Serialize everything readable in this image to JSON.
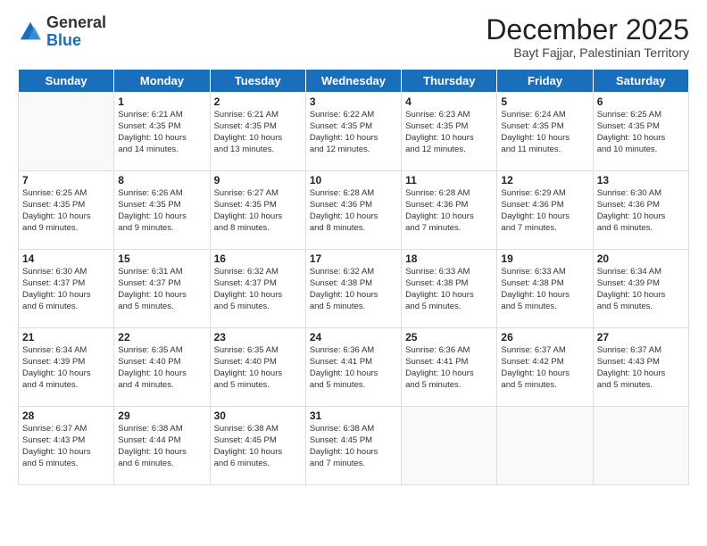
{
  "header": {
    "logo_general": "General",
    "logo_blue": "Blue",
    "month_title": "December 2025",
    "subtitle": "Bayt Fajjar, Palestinian Territory"
  },
  "days": [
    "Sunday",
    "Monday",
    "Tuesday",
    "Wednesday",
    "Thursday",
    "Friday",
    "Saturday"
  ],
  "weeks": [
    [
      {
        "date": "",
        "info": ""
      },
      {
        "date": "1",
        "info": "Sunrise: 6:21 AM\nSunset: 4:35 PM\nDaylight: 10 hours\nand 14 minutes."
      },
      {
        "date": "2",
        "info": "Sunrise: 6:21 AM\nSunset: 4:35 PM\nDaylight: 10 hours\nand 13 minutes."
      },
      {
        "date": "3",
        "info": "Sunrise: 6:22 AM\nSunset: 4:35 PM\nDaylight: 10 hours\nand 12 minutes."
      },
      {
        "date": "4",
        "info": "Sunrise: 6:23 AM\nSunset: 4:35 PM\nDaylight: 10 hours\nand 12 minutes."
      },
      {
        "date": "5",
        "info": "Sunrise: 6:24 AM\nSunset: 4:35 PM\nDaylight: 10 hours\nand 11 minutes."
      },
      {
        "date": "6",
        "info": "Sunrise: 6:25 AM\nSunset: 4:35 PM\nDaylight: 10 hours\nand 10 minutes."
      }
    ],
    [
      {
        "date": "7",
        "info": "Sunrise: 6:25 AM\nSunset: 4:35 PM\nDaylight: 10 hours\nand 9 minutes."
      },
      {
        "date": "8",
        "info": "Sunrise: 6:26 AM\nSunset: 4:35 PM\nDaylight: 10 hours\nand 9 minutes."
      },
      {
        "date": "9",
        "info": "Sunrise: 6:27 AM\nSunset: 4:35 PM\nDaylight: 10 hours\nand 8 minutes."
      },
      {
        "date": "10",
        "info": "Sunrise: 6:28 AM\nSunset: 4:36 PM\nDaylight: 10 hours\nand 8 minutes."
      },
      {
        "date": "11",
        "info": "Sunrise: 6:28 AM\nSunset: 4:36 PM\nDaylight: 10 hours\nand 7 minutes."
      },
      {
        "date": "12",
        "info": "Sunrise: 6:29 AM\nSunset: 4:36 PM\nDaylight: 10 hours\nand 7 minutes."
      },
      {
        "date": "13",
        "info": "Sunrise: 6:30 AM\nSunset: 4:36 PM\nDaylight: 10 hours\nand 6 minutes."
      }
    ],
    [
      {
        "date": "14",
        "info": "Sunrise: 6:30 AM\nSunset: 4:37 PM\nDaylight: 10 hours\nand 6 minutes."
      },
      {
        "date": "15",
        "info": "Sunrise: 6:31 AM\nSunset: 4:37 PM\nDaylight: 10 hours\nand 5 minutes."
      },
      {
        "date": "16",
        "info": "Sunrise: 6:32 AM\nSunset: 4:37 PM\nDaylight: 10 hours\nand 5 minutes."
      },
      {
        "date": "17",
        "info": "Sunrise: 6:32 AM\nSunset: 4:38 PM\nDaylight: 10 hours\nand 5 minutes."
      },
      {
        "date": "18",
        "info": "Sunrise: 6:33 AM\nSunset: 4:38 PM\nDaylight: 10 hours\nand 5 minutes."
      },
      {
        "date": "19",
        "info": "Sunrise: 6:33 AM\nSunset: 4:38 PM\nDaylight: 10 hours\nand 5 minutes."
      },
      {
        "date": "20",
        "info": "Sunrise: 6:34 AM\nSunset: 4:39 PM\nDaylight: 10 hours\nand 5 minutes."
      }
    ],
    [
      {
        "date": "21",
        "info": "Sunrise: 6:34 AM\nSunset: 4:39 PM\nDaylight: 10 hours\nand 4 minutes."
      },
      {
        "date": "22",
        "info": "Sunrise: 6:35 AM\nSunset: 4:40 PM\nDaylight: 10 hours\nand 4 minutes."
      },
      {
        "date": "23",
        "info": "Sunrise: 6:35 AM\nSunset: 4:40 PM\nDaylight: 10 hours\nand 5 minutes."
      },
      {
        "date": "24",
        "info": "Sunrise: 6:36 AM\nSunset: 4:41 PM\nDaylight: 10 hours\nand 5 minutes."
      },
      {
        "date": "25",
        "info": "Sunrise: 6:36 AM\nSunset: 4:41 PM\nDaylight: 10 hours\nand 5 minutes."
      },
      {
        "date": "26",
        "info": "Sunrise: 6:37 AM\nSunset: 4:42 PM\nDaylight: 10 hours\nand 5 minutes."
      },
      {
        "date": "27",
        "info": "Sunrise: 6:37 AM\nSunset: 4:43 PM\nDaylight: 10 hours\nand 5 minutes."
      }
    ],
    [
      {
        "date": "28",
        "info": "Sunrise: 6:37 AM\nSunset: 4:43 PM\nDaylight: 10 hours\nand 5 minutes."
      },
      {
        "date": "29",
        "info": "Sunrise: 6:38 AM\nSunset: 4:44 PM\nDaylight: 10 hours\nand 6 minutes."
      },
      {
        "date": "30",
        "info": "Sunrise: 6:38 AM\nSunset: 4:45 PM\nDaylight: 10 hours\nand 6 minutes."
      },
      {
        "date": "31",
        "info": "Sunrise: 6:38 AM\nSunset: 4:45 PM\nDaylight: 10 hours\nand 7 minutes."
      },
      {
        "date": "",
        "info": ""
      },
      {
        "date": "",
        "info": ""
      },
      {
        "date": "",
        "info": ""
      }
    ]
  ]
}
